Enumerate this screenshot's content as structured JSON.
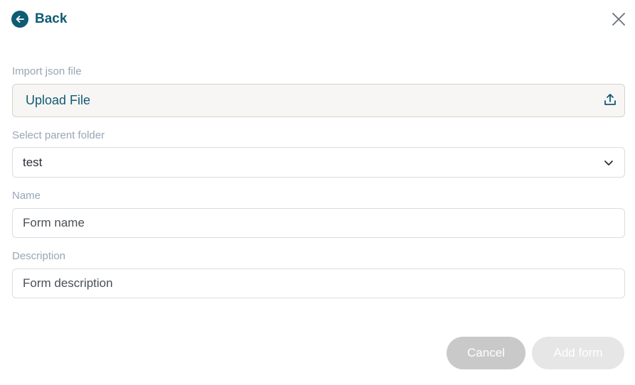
{
  "header": {
    "back_label": "Back",
    "back_icon": "arrow-left-circle-icon",
    "close_icon": "close-icon"
  },
  "form": {
    "import": {
      "label": "Import json file",
      "button_text": "Upload File",
      "icon": "upload-icon"
    },
    "parent_folder": {
      "label": "Select parent folder",
      "value": "test",
      "icon": "chevron-down-icon"
    },
    "name": {
      "label": "Name",
      "value": "",
      "placeholder": "Form name"
    },
    "description": {
      "label": "Description",
      "value": "",
      "placeholder": "Form description"
    }
  },
  "actions": {
    "cancel_label": "Cancel",
    "add_label": "Add form"
  },
  "colors": {
    "accent": "#0f5b73",
    "label": "#98a6b6",
    "cancel_bg": "#c9c9c9",
    "add_bg_disabled": "#e6e6e6"
  }
}
